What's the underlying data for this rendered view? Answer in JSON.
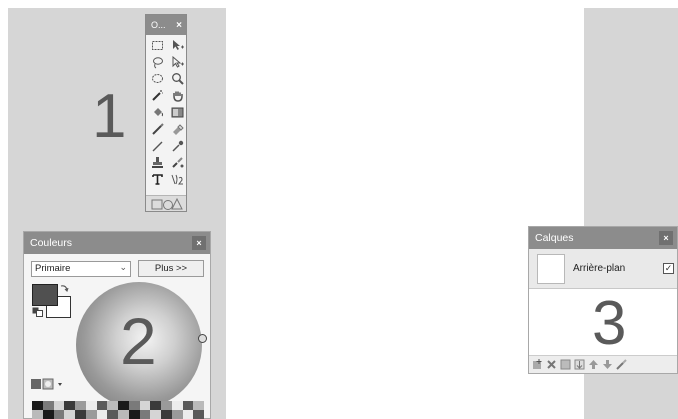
{
  "canvas_labels": {
    "one": "1",
    "two": "2",
    "three": "3"
  },
  "tools_window": {
    "title": "O...",
    "close": "×",
    "tools": [
      {
        "name": "rectangle-select-icon"
      },
      {
        "name": "move-selected-pixels-icon"
      },
      {
        "name": "lasso-select-icon"
      },
      {
        "name": "move-selection-icon"
      },
      {
        "name": "ellipse-select-icon"
      },
      {
        "name": "zoom-icon"
      },
      {
        "name": "magic-wand-icon"
      },
      {
        "name": "pan-icon"
      },
      {
        "name": "paint-bucket-icon"
      },
      {
        "name": "gradient-icon"
      },
      {
        "name": "paintbrush-icon"
      },
      {
        "name": "eraser-icon"
      },
      {
        "name": "pencil-icon"
      },
      {
        "name": "color-picker-icon"
      },
      {
        "name": "clone-stamp-icon"
      },
      {
        "name": "recolor-icon"
      },
      {
        "name": "text-icon"
      },
      {
        "name": "line-curve-icon"
      }
    ]
  },
  "colors_window": {
    "title": "Couleurs",
    "close": "×",
    "mode_select": "Primaire",
    "more_button": "Plus >>",
    "primary_color": "#505050",
    "secondary_color": "#ffffff"
  },
  "layers_window": {
    "title": "Calques",
    "close": "×",
    "layer_name": "Arrière-plan",
    "layer_visible": true,
    "toolbar": [
      "add-layer-icon",
      "delete-layer-icon",
      "duplicate-layer-icon",
      "merge-layer-icon",
      "move-up-icon",
      "move-down-icon",
      "properties-icon"
    ]
  },
  "colors": {
    "titlebar": "#8c8c8c",
    "strip": "#d6d6d6",
    "label": "#5a5a5a"
  }
}
